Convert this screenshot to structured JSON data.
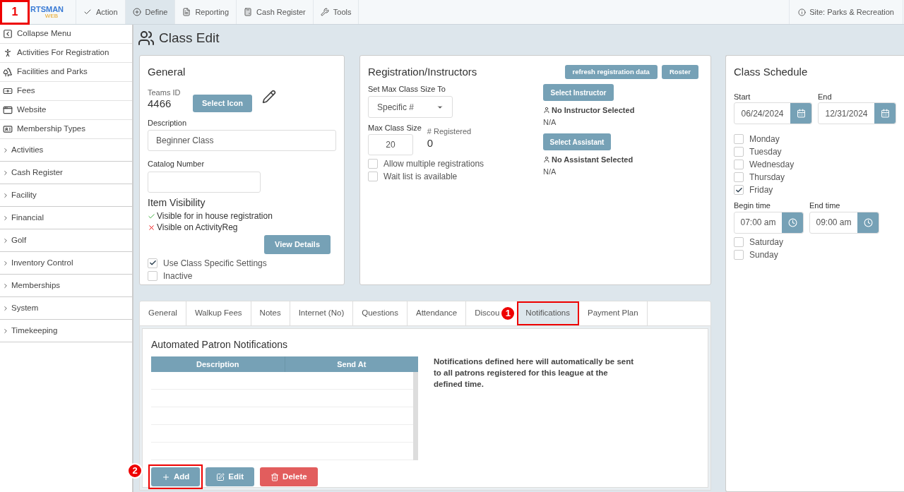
{
  "top_nav": {
    "logo_text": "RTSMAN",
    "logo_sub": "WEB",
    "callout": "1",
    "items": [
      {
        "label": "Action",
        "selected": false
      },
      {
        "label": "Define",
        "selected": true
      },
      {
        "label": "Reporting",
        "selected": false
      },
      {
        "label": "Cash Register",
        "selected": false
      },
      {
        "label": "Tools",
        "selected": false
      }
    ],
    "site": "Site: Parks & Recreation"
  },
  "sidebar": {
    "items": [
      {
        "label": "Collapse Menu",
        "kind": "link"
      },
      {
        "label": "Activities For Registration",
        "kind": "link"
      },
      {
        "label": "Facilities and Parks",
        "kind": "link"
      },
      {
        "label": "Fees",
        "kind": "link"
      },
      {
        "label": "Website",
        "kind": "link"
      },
      {
        "label": "Membership Types",
        "kind": "link"
      },
      {
        "label": "Activities",
        "kind": "group"
      },
      {
        "label": "Cash Register",
        "kind": "group"
      },
      {
        "label": "Facility",
        "kind": "group"
      },
      {
        "label": "Financial",
        "kind": "group"
      },
      {
        "label": "Golf",
        "kind": "group"
      },
      {
        "label": "Inventory Control",
        "kind": "group"
      },
      {
        "label": "Memberships",
        "kind": "group"
      },
      {
        "label": "System",
        "kind": "group"
      },
      {
        "label": "Timekeeping",
        "kind": "group"
      }
    ]
  },
  "page_title": "Class Edit",
  "general": {
    "title": "General",
    "teams_id_label": "Teams ID",
    "teams_id": "4466",
    "select_icon": "Select Icon",
    "description_label": "Description",
    "description": "Beginner Class",
    "catalog_label": "Catalog Number",
    "visibility_title": "Item Visibility",
    "visibility": [
      {
        "label": "Visible for in house registration",
        "visible": true
      },
      {
        "label": "Visible on ActivityReg",
        "visible": false
      }
    ],
    "view_details": "View Details",
    "checkboxes": [
      {
        "label": "Use Class Specific Settings",
        "checked": true
      },
      {
        "label": "Inactive",
        "checked": false
      }
    ]
  },
  "registration": {
    "title": "Registration/Instructors",
    "refresh": "refresh registration data",
    "roster": "Roster",
    "max_size_label": "Set Max Class Size To",
    "max_size_select": "Specific #",
    "max_class_size_label": "Max Class Size",
    "max_class_size": "20",
    "registered_label": "# Registered",
    "registered": "0",
    "checkboxes": [
      {
        "label": "Allow multiple registrations",
        "checked": false
      },
      {
        "label": "Wait list is available",
        "checked": false
      }
    ],
    "select_instructor": "Select Instructor",
    "instructor": "No Instructor Selected",
    "instructor_sub": "N/A",
    "select_assistant": "Select Assistant",
    "assistant": "No Assistant Selected",
    "assistant_sub": "N/A"
  },
  "schedule": {
    "title": "Class Schedule",
    "start_label": "Start",
    "start": "06/24/2024",
    "end_label": "End",
    "end": "12/31/2024",
    "days_a": [
      {
        "label": "Monday",
        "checked": false
      },
      {
        "label": "Tuesday",
        "checked": false
      },
      {
        "label": "Wednesday",
        "checked": false
      },
      {
        "label": "Thursday",
        "checked": false
      },
      {
        "label": "Friday",
        "checked": true
      }
    ],
    "begin_label": "Begin time",
    "begin": "07:00 am",
    "end_time_label": "End time",
    "end_time": "09:00 am",
    "days_b": [
      {
        "label": "Saturday",
        "checked": false
      },
      {
        "label": "Sunday",
        "checked": false
      }
    ]
  },
  "tabs": [
    {
      "label": "General",
      "selected": false,
      "highlighted": false
    },
    {
      "label": "Walkup Fees",
      "selected": false,
      "highlighted": false
    },
    {
      "label": "Notes",
      "selected": false,
      "highlighted": false
    },
    {
      "label": "Internet (No)",
      "selected": false,
      "highlighted": false
    },
    {
      "label": "Questions",
      "selected": false,
      "highlighted": false
    },
    {
      "label": "Attendance",
      "selected": false,
      "highlighted": false
    },
    {
      "label": "Discou",
      "selected": false,
      "highlighted": false,
      "callout": "1"
    },
    {
      "label": "Notifications",
      "selected": true,
      "highlighted": true
    },
    {
      "label": "Payment Plan",
      "selected": false,
      "highlighted": false
    }
  ],
  "notifications": {
    "title": "Automated Patron Notifications",
    "columns": [
      "Description",
      "Send At"
    ],
    "info": "Notifications defined here will automatically be sent to all patrons registered for this league at the defined time.",
    "buttons": [
      {
        "label": "Add",
        "kind": "add",
        "highlighted": true,
        "callout": "2"
      },
      {
        "label": "Edit",
        "kind": "edit",
        "highlighted": false
      },
      {
        "label": "Delete",
        "kind": "delete",
        "highlighted": false
      }
    ]
  }
}
